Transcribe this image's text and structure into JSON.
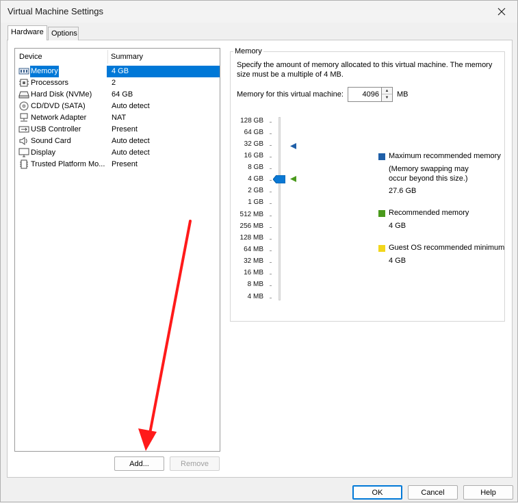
{
  "window": {
    "title": "Virtual Machine Settings"
  },
  "tabs": [
    {
      "label": "Hardware",
      "active": true
    },
    {
      "label": "Options",
      "active": false
    }
  ],
  "device_list": {
    "columns": {
      "device": "Device",
      "summary": "Summary"
    },
    "rows": [
      {
        "icon": "memory-icon",
        "device": "Memory",
        "summary": "4 GB",
        "selected": true
      },
      {
        "icon": "processor-icon",
        "device": "Processors",
        "summary": "2"
      },
      {
        "icon": "hard-disk-icon",
        "device": "Hard Disk (NVMe)",
        "summary": "64 GB"
      },
      {
        "icon": "cd-dvd-icon",
        "device": "CD/DVD (SATA)",
        "summary": "Auto detect"
      },
      {
        "icon": "network-adapter-icon",
        "device": "Network Adapter",
        "summary": "NAT"
      },
      {
        "icon": "usb-icon",
        "device": "USB Controller",
        "summary": "Present"
      },
      {
        "icon": "sound-card-icon",
        "device": "Sound Card",
        "summary": "Auto detect"
      },
      {
        "icon": "display-icon",
        "device": "Display",
        "summary": "Auto detect"
      },
      {
        "icon": "tpm-icon",
        "device": "Trusted Platform Mo...",
        "summary": "Present"
      }
    ],
    "add_label": "Add...",
    "remove_label": "Remove"
  },
  "memory": {
    "group_title": "Memory",
    "description": "Specify the amount of memory allocated to this virtual machine. The memory size must be a multiple of 4 MB.",
    "field_label": "Memory for this virtual machine:",
    "value": "4096",
    "unit": "MB",
    "scale": [
      "128 GB",
      "64 GB",
      "32 GB",
      "16 GB",
      "8 GB",
      "4 GB",
      "2 GB",
      "1 GB",
      "512 MB",
      "256 MB",
      "128 MB",
      "64 MB",
      "32 MB",
      "16 MB",
      "8 MB",
      "4 MB"
    ],
    "current_level": "4 GB",
    "legend": {
      "max": {
        "title": "Maximum recommended memory",
        "note": "(Memory swapping may occur beyond this size.)",
        "note_line1": "(Memory swapping may",
        "note_line2": "occur beyond this size.)",
        "value": "27.6 GB",
        "color": "#1f5fa8"
      },
      "recommended": {
        "title": "Recommended memory",
        "value": "4 GB",
        "color": "#4a9a1c"
      },
      "guest_min": {
        "title": "Guest OS recommended minimum",
        "value": "4 GB",
        "color": "#f2d61c"
      }
    }
  },
  "buttons": {
    "ok": "OK",
    "cancel": "Cancel",
    "help": "Help"
  },
  "colors": {
    "selection": "#0078d7",
    "annotation_arrow": "#ff1a1a"
  }
}
